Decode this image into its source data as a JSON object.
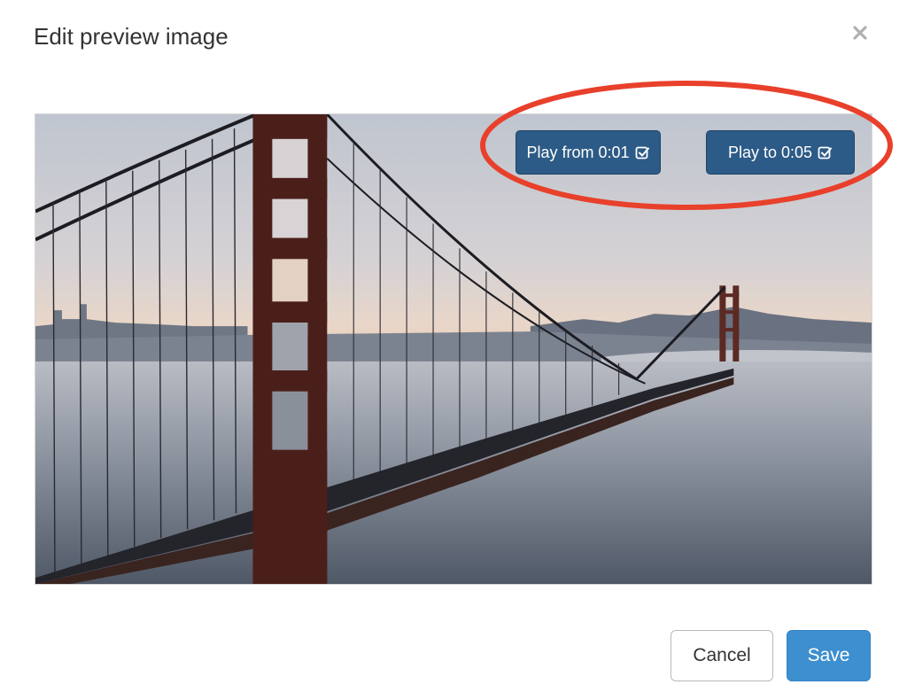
{
  "dialog": {
    "title": "Edit preview image",
    "close_icon": "close-icon"
  },
  "preview": {
    "description_icon": "bridge-photo",
    "play_from_label": "Play from 0:01",
    "play_to_label": "Play to 0:05",
    "check_icon": "check-square-icon",
    "callout_color": "#e8402b",
    "button_color": "#2d5b87"
  },
  "footer": {
    "cancel_label": "Cancel",
    "save_label": "Save",
    "save_color": "#3d8fcf"
  }
}
